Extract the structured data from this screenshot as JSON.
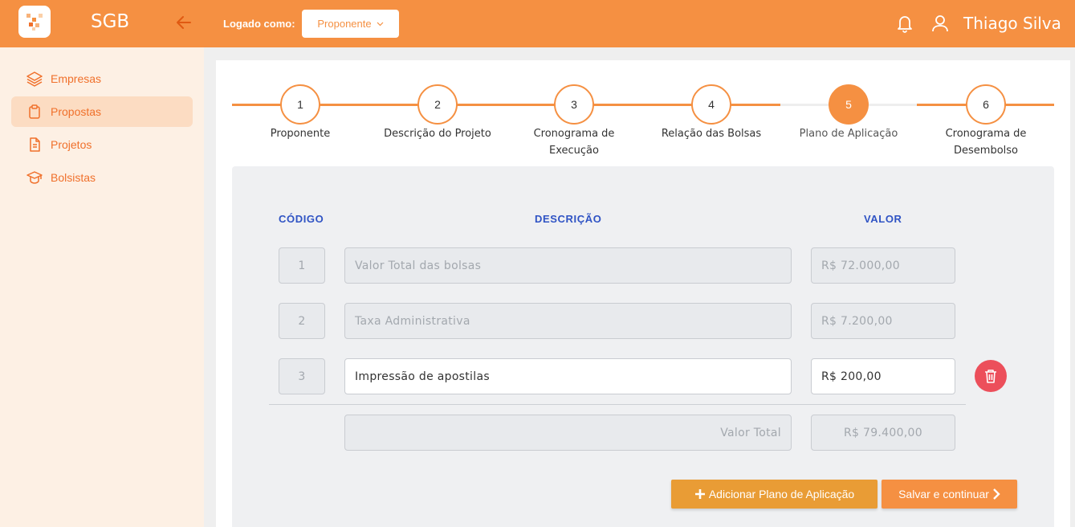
{
  "app": {
    "name": "SGB"
  },
  "sidebar": {
    "items": [
      {
        "label": "Empresas",
        "icon": "layers-icon"
      },
      {
        "label": "Propostas",
        "icon": "clipboard-icon",
        "active": true
      },
      {
        "label": "Projetos",
        "icon": "document-icon"
      },
      {
        "label": "Bolsistas",
        "icon": "graduation-cap-icon"
      }
    ]
  },
  "topbar": {
    "logged_as_label": "Logado como:",
    "role_value": "Proponente",
    "user_name": "Thiago Silva"
  },
  "stepper": {
    "current_step": 5,
    "steps": [
      {
        "number": "1",
        "label": "Proponente"
      },
      {
        "number": "2",
        "label": "Descrição do Projeto"
      },
      {
        "number": "3",
        "label": "Cronograma de Execução"
      },
      {
        "number": "4",
        "label": "Relação das Bolsas"
      },
      {
        "number": "5",
        "label": "Plano de Aplicação"
      },
      {
        "number": "6",
        "label": "Cronograma de Desembolso"
      }
    ]
  },
  "table": {
    "headers": {
      "code": "CÓDIGO",
      "description": "DESCRIÇÃO",
      "value": "VALOR"
    },
    "rows": [
      {
        "code": "1",
        "description": "Valor Total das bolsas",
        "value": "R$ 72.000,00",
        "editable": false
      },
      {
        "code": "2",
        "description": "Taxa Administrativa",
        "value": "R$ 7.200,00",
        "editable": false
      },
      {
        "code": "3",
        "description": "Impressão de apostilas",
        "value": "R$ 200,00",
        "editable": true
      }
    ],
    "total_label": "Valor Total",
    "total_value": "R$ 79.400,00"
  },
  "actions": {
    "add_label": "Adicionar Plano de Aplicação",
    "save_label": "Salvar e continuar"
  },
  "colors": {
    "brand": "#f59042",
    "sidebar_bg": "#fdf0e4",
    "header_text": "#2f53c4",
    "danger": "#ec4f5b",
    "add_button": "#e99c35"
  }
}
